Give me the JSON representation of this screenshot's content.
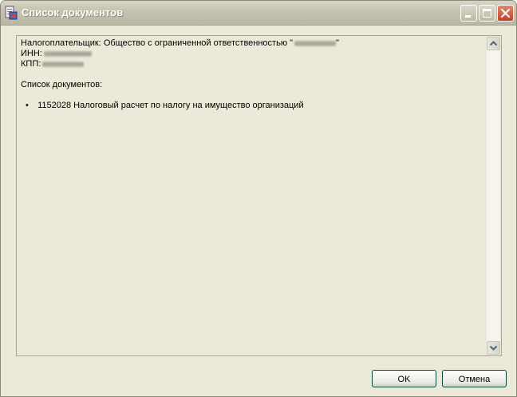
{
  "window": {
    "title": "Список документов"
  },
  "content": {
    "taxpayer_label": "Налогоплательщик:",
    "taxpayer_name": "Общество с ограниченной ответственностью \"",
    "taxpayer_name_close": "\"",
    "inn_label": "ИНН:",
    "kpp_label": "КПП:",
    "documents_heading": "Список документов:",
    "documents": [
      {
        "code": "1152028",
        "name": "Налоговый расчет по налогу на имущество организаций"
      }
    ]
  },
  "buttons": {
    "ok": "OK",
    "cancel": "Отмена"
  },
  "icons": {
    "app": "document-list-icon",
    "minimize": "minimize-icon",
    "maximize": "maximize-icon",
    "close": "close-icon",
    "scroll_up": "scroll-up-arrow-icon",
    "scroll_down": "scroll-down-arrow-icon"
  },
  "colors": {
    "window_bg": "#ece9d8",
    "close_button": "#cc3d1f",
    "arrow": "#4d6185"
  }
}
